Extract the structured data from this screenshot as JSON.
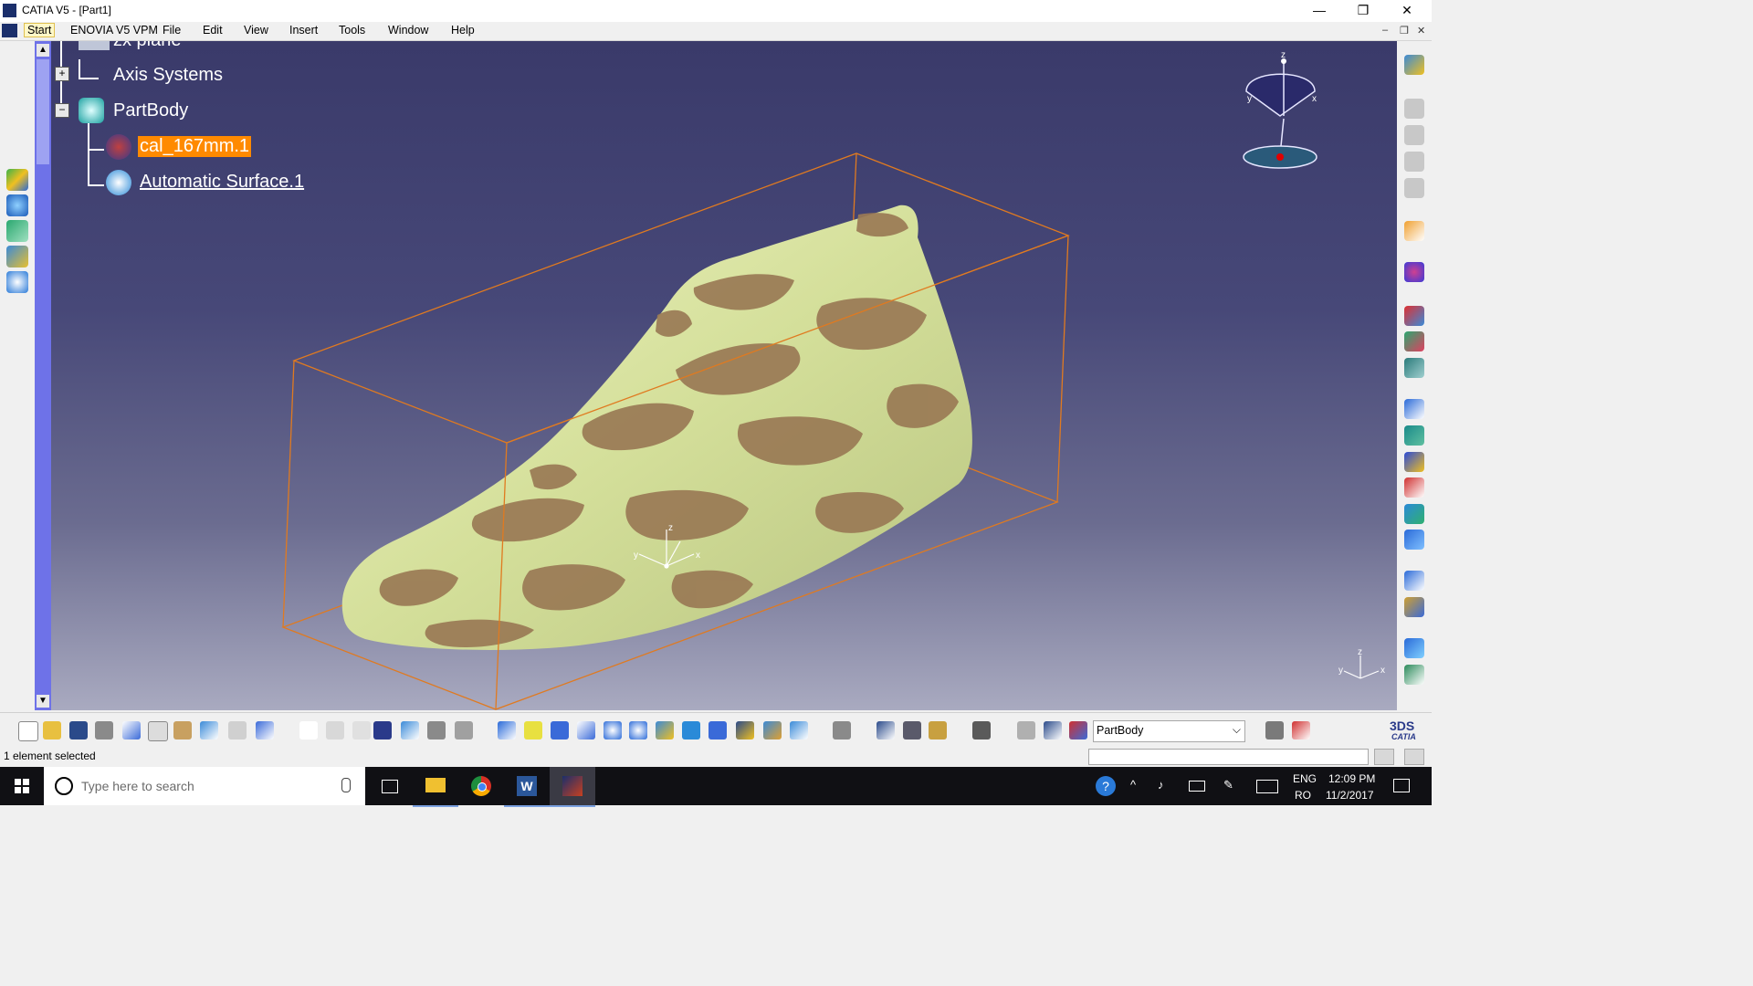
{
  "window": {
    "title": "CATIA V5 - [Part1]",
    "minimize": "—",
    "maximize": "❐",
    "close": "✕"
  },
  "menu": {
    "items": [
      "Start",
      "ENOVIA V5 VPM",
      "File",
      "Edit",
      "View",
      "Insert",
      "Tools",
      "Window",
      "Help"
    ],
    "active": "Start"
  },
  "tree": {
    "partial_item": "zx plane",
    "items": [
      {
        "label": "Axis Systems",
        "icon": "axis-systems-icon",
        "expander": "+"
      },
      {
        "label": "PartBody",
        "icon": "partbody-icon",
        "expander": "−"
      },
      {
        "label": "cal_167mm.1",
        "icon": "cloud-points-icon",
        "selected": true
      },
      {
        "label": "Automatic Surface.1",
        "icon": "surface-icon",
        "selected": false
      }
    ]
  },
  "compass": {
    "z": "z",
    "x": "x",
    "y": "y"
  },
  "axis_triad": {
    "x": "x",
    "y": "y",
    "z": "z"
  },
  "model_triad": {
    "x": "x",
    "y": "y",
    "z": "z"
  },
  "toolbar": {
    "current_body": "PartBody",
    "logo": "CATIA"
  },
  "status": {
    "text": "1 element selected"
  },
  "taskbar": {
    "search_placeholder": "Type here to search",
    "lang_top": "ENG",
    "lang_bottom": "RO",
    "time": "12:09 PM",
    "date": "11/2/2017"
  },
  "colors": {
    "viewport_top": "#3a3a6a",
    "selection": "#ff8a00",
    "bbox": "#e07a20",
    "model_light": "#d9e3a0",
    "model_dark": "#9a7a55"
  }
}
